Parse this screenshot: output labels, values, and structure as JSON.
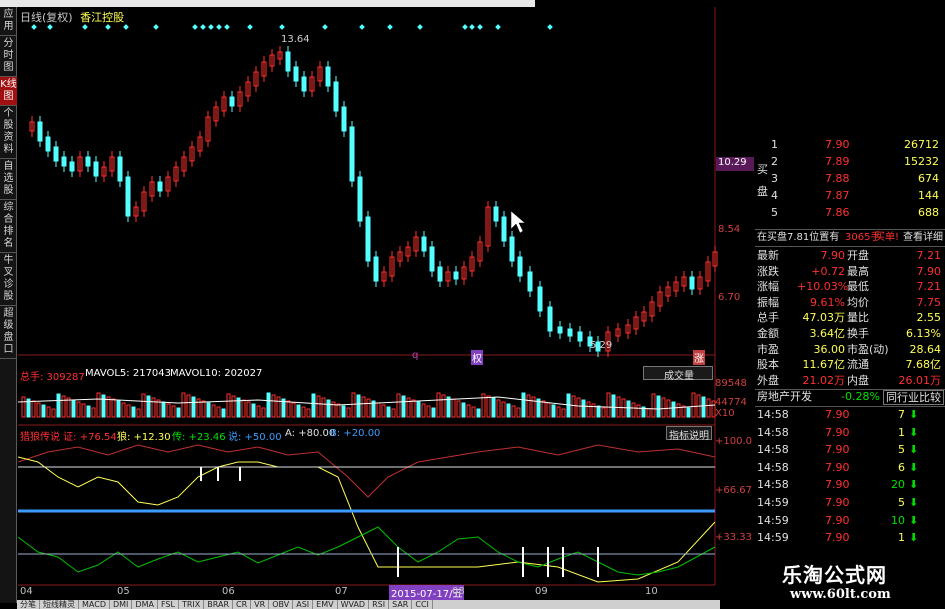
{
  "window": {
    "title": "日线(复权)",
    "stock_name": "香江控股"
  },
  "sidebar": {
    "tabs": [
      {
        "label": "应用",
        "active": false
      },
      {
        "label": "分时图",
        "active": false
      },
      {
        "label": "K线图",
        "active": true
      },
      {
        "label": "个股资料",
        "active": false
      },
      {
        "label": "自选股",
        "active": false
      },
      {
        "label": "综合排名",
        "active": false
      },
      {
        "label": "牛叉诊股",
        "active": false
      },
      {
        "label": "超级盘口",
        "active": false
      }
    ]
  },
  "price_chart": {
    "high_marker": "13.64",
    "low_marker": "5.29",
    "current_price_tag": "10.29",
    "axis_ticks": [
      "8.54",
      "6.70"
    ],
    "event_marks": [
      "q",
      "权",
      "涨"
    ]
  },
  "volume_panel": {
    "total_label": "总手: 309287",
    "ma5_label": "MAVOL5: 217043",
    "ma10_label": "MAVOL10: 202027",
    "dropdown": "成交量",
    "axis_ticks": [
      "89548",
      "44774",
      "X10"
    ]
  },
  "indicator_panel": {
    "name": "猎狼传说 证: +76.54",
    "values": [
      "狼: +12.30",
      "传: +23.46",
      "说: +50.00",
      "A: +80.00",
      "B: +20.00"
    ],
    "help_button": "指标说明",
    "axis_ticks": [
      "+100.0",
      "+66.67",
      "+33.33"
    ]
  },
  "x_axis": {
    "labels": [
      "04",
      "05",
      "06",
      "07",
      "08",
      "09",
      "10"
    ],
    "cursor_date": "2015-07-17/五"
  },
  "order_book": {
    "sell": [
      {
        "level": "1",
        "price": "7.90",
        "volume": "26712"
      },
      {
        "level": "2",
        "price": "7.89",
        "volume": "15232"
      },
      {
        "level": "3",
        "price": "7.88",
        "volume": "674"
      },
      {
        "level": "4",
        "price": "7.87",
        "volume": "144"
      },
      {
        "level": "5",
        "price": "7.86",
        "volume": "688"
      }
    ],
    "side_label": "买盘",
    "notice": "在买盘7.81位置有",
    "notice_qty": "3065手",
    "notice_action": "买单!",
    "detail_link": "查看详细"
  },
  "quote_stats": [
    {
      "l1": "最新",
      "v1": "7.90",
      "l2": "开盘",
      "v2": "7.21"
    },
    {
      "l1": "涨跌",
      "v1": "+0.72",
      "l2": "最高",
      "v2": "7.90"
    },
    {
      "l1": "涨幅",
      "v1": "+10.03%",
      "l2": "最低",
      "v2": "7.21"
    },
    {
      "l1": "振幅",
      "v1": "9.61%",
      "l2": "均价",
      "v2": "7.75"
    },
    {
      "l1": "总手",
      "v1": "47.03万",
      "l2": "量比",
      "v2": "2.55"
    },
    {
      "l1": "金额",
      "v1": "3.64亿",
      "l2": "换手",
      "v2": "6.13%"
    },
    {
      "l1": "市盈",
      "v1": "36.00",
      "l2": "市盈(动)",
      "v2": "28.64"
    },
    {
      "l1": "股本",
      "v1": "11.67亿",
      "l2": "流通",
      "v2": "7.68亿"
    },
    {
      "l1": "外盘",
      "v1": "21.02万",
      "l2": "内盘",
      "v2": "26.01万"
    }
  ],
  "sector": {
    "name": "房地产开发",
    "change": "-0.28%",
    "compare_button": "同行业比较"
  },
  "ticks": [
    {
      "time": "14:58",
      "price": "7.90",
      "vol": "7"
    },
    {
      "time": "14:58",
      "price": "7.90",
      "vol": "1"
    },
    {
      "time": "14:58",
      "price": "7.90",
      "vol": "5"
    },
    {
      "time": "14:58",
      "price": "7.90",
      "vol": "6"
    },
    {
      "time": "14:58",
      "price": "7.90",
      "vol": "20"
    },
    {
      "time": "14:59",
      "price": "7.90",
      "vol": "5"
    },
    {
      "time": "14:59",
      "price": "7.90",
      "vol": "10"
    },
    {
      "time": "14:59",
      "price": "7.90",
      "vol": "1"
    }
  ],
  "bottom_tabs": [
    "分笔",
    "短线精灵",
    "MACD",
    "DMI",
    "DMA",
    "FSL",
    "TRIX",
    "BRAR",
    "CR",
    "VR",
    "OBV",
    "ASI",
    "EMV",
    "WVAD",
    "RSI",
    "SAR",
    "CCI"
  ],
  "watermark": {
    "title": "乐淘公式网",
    "url": "www.60lt.com"
  },
  "colors": {
    "up": "#ff3030",
    "down": "#54ffff",
    "yellow": "#ffff54",
    "green": "#00e000",
    "blue": "#3c9cff"
  }
}
